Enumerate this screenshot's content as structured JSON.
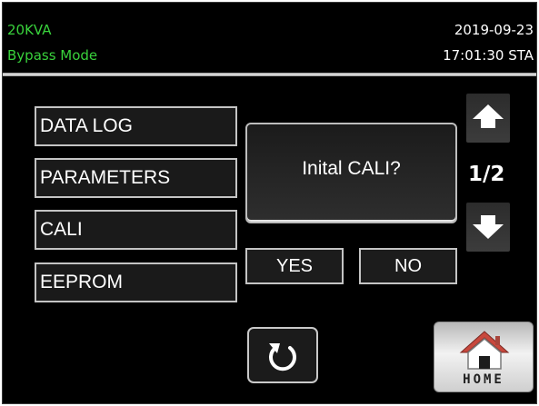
{
  "status_bar": {
    "capacity": "20KVA",
    "mode": "Bypass Mode",
    "date": "2019-09-23",
    "time": "17:01:30 STA",
    "mode_color": "#39d23c"
  },
  "menu": {
    "items": [
      {
        "label": "DATA LOG"
      },
      {
        "label": "PARAMETERS"
      },
      {
        "label": "CALI"
      },
      {
        "label": "EEPROM"
      }
    ]
  },
  "dialog": {
    "message": "Inital CALI?",
    "yes_label": "YES",
    "no_label": "NO"
  },
  "pager": {
    "indicator": "1/2",
    "up_icon": "arrow-up-icon",
    "down_icon": "arrow-down-icon"
  },
  "footer": {
    "back_icon": "refresh-icon",
    "home_label": "HOME",
    "home_icon": "house-icon"
  }
}
